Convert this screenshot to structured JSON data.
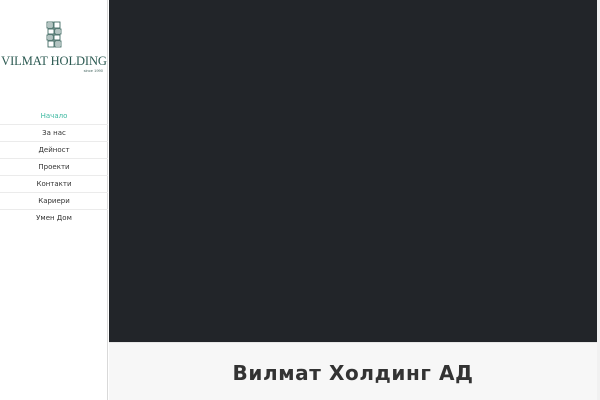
{
  "brand": {
    "name": "VILMAT HOLDING",
    "since": "since 1990"
  },
  "nav": {
    "items": [
      {
        "label": "Начало"
      },
      {
        "label": "За нас"
      },
      {
        "label": "Дейност"
      },
      {
        "label": "Проекти"
      },
      {
        "label": "Контакти"
      },
      {
        "label": "Кариери"
      },
      {
        "label": "Умен Дом"
      }
    ],
    "active_index": 0
  },
  "main": {
    "title": "Вилмат Холдинг АД"
  },
  "colors": {
    "accent": "#3bb8a0",
    "logo": "#2c5a52",
    "hero_background": "#222529"
  },
  "icons": {
    "logo": "building-grid-icon"
  }
}
